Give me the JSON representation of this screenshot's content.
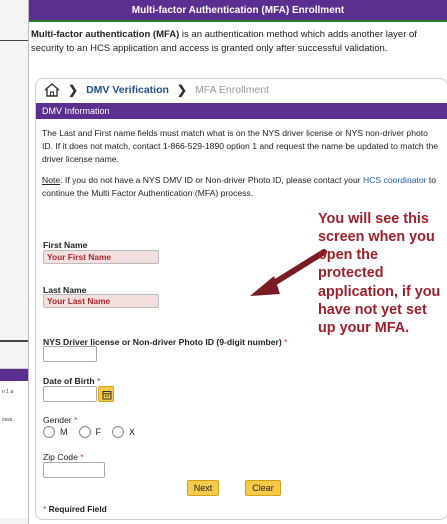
{
  "window": {
    "title": "Multi-factor Authentication (MFA) Enrollment",
    "intro_bold": "Multi-factor authentication (MFA)",
    "intro_rest": " is an authentication method which adds another layer of security to an HCS application and access is granted only after successful validation."
  },
  "breadcrumb": {
    "home_icon": "home-icon",
    "items": [
      "DMV Verification",
      "MFA Enrollment"
    ]
  },
  "section": {
    "title": "DMV Information",
    "paragraph": "The Last and First name fields must match what is on the NYS driver license or NYS non-driver photo ID. If it does not match, contact 1-866-529-1890 option 1 and request the name be updated to match the driver license name.",
    "note_label": "Note",
    "note_text_1": ": If you do not have a NYS DMV ID or Non-driver Photo ID, please contact your ",
    "note_link": "HCS coordinator",
    "note_text_2": " to continue the Multi Factor Authentication (MFA) process."
  },
  "form": {
    "first_name_label": "First Name",
    "first_name_value": "Your First Name",
    "last_name_label": "Last Name",
    "last_name_value": "Your Last Name",
    "dmv_id_label": "NYS Driver license or Non-driver Photo ID (9-digit number)",
    "required_mark": "*",
    "dob_label": "Date of Birth",
    "gender_label": "Gender",
    "gender_options": [
      "M",
      "F",
      "X"
    ],
    "zip_label": "Zip Code",
    "next_label": "Next",
    "clear_label": "Clear",
    "required_note": "Required Field"
  },
  "callout": {
    "text": "You will see this screen when you open the protected application, if you have not yet set up your MFA."
  },
  "colors": {
    "header_purple": "#5b2f8f",
    "button_yellow": "#f7c948",
    "callout_red": "#a11f2a",
    "link_blue": "#1f5fa8"
  }
}
